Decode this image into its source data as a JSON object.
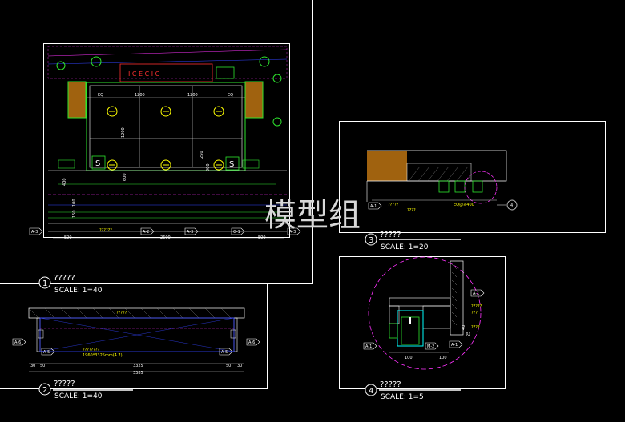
{
  "watermark": "模型组",
  "views": [
    {
      "number": "1",
      "title": "?????",
      "scale": "SCALE: 1=40"
    },
    {
      "number": "2",
      "title": "?????",
      "scale": "SCALE: 1=40"
    },
    {
      "number": "3",
      "title": "?????",
      "scale": "SCALE: 1=20"
    },
    {
      "number": "4",
      "title": "?????",
      "scale": "SCALE: 1=5"
    }
  ],
  "plan": {
    "dims_top": [
      "EQ",
      "1200",
      "1200",
      "EQ"
    ],
    "dims_bottom": [
      "500",
      "2600",
      "500"
    ],
    "dims_side": [
      "1200",
      "600",
      "200",
      "50",
      "250",
      "50",
      "200",
      "400",
      "100",
      "150"
    ],
    "socket_label": "S",
    "tags": [
      "A-3",
      "A-2",
      "A-3",
      "G-1",
      "A-3"
    ],
    "note": "??????"
  },
  "elevation": {
    "top_note": "?????",
    "center_note1": "????????",
    "center_note2": "1960*3325mm(4.7)",
    "dims": [
      "30",
      "50",
      "3325",
      "50",
      "30",
      "3385",
      "30",
      "30"
    ],
    "tags": [
      "A-6",
      "A-5",
      "A-6",
      "A-5"
    ]
  },
  "section3": {
    "note1": "?????",
    "note2": "????",
    "note3": "EQ@≤400",
    "tags": [
      "A-1",
      "4"
    ]
  },
  "detail4": {
    "tags": [
      "A-1",
      "M-2",
      "A-1",
      "A-1"
    ],
    "notes": [
      "?????",
      "???",
      "????"
    ],
    "dims": [
      "100",
      "100",
      "40",
      "25"
    ]
  },
  "colors": {
    "background": "#000000",
    "frame": "#ffffff",
    "green": "#2ee52e",
    "yellow": "#ffff00",
    "magenta": "#ff33ff",
    "cyan": "#00ffff",
    "blue": "#3344ff",
    "brown": "#a0620f",
    "red": "#ff3030"
  }
}
